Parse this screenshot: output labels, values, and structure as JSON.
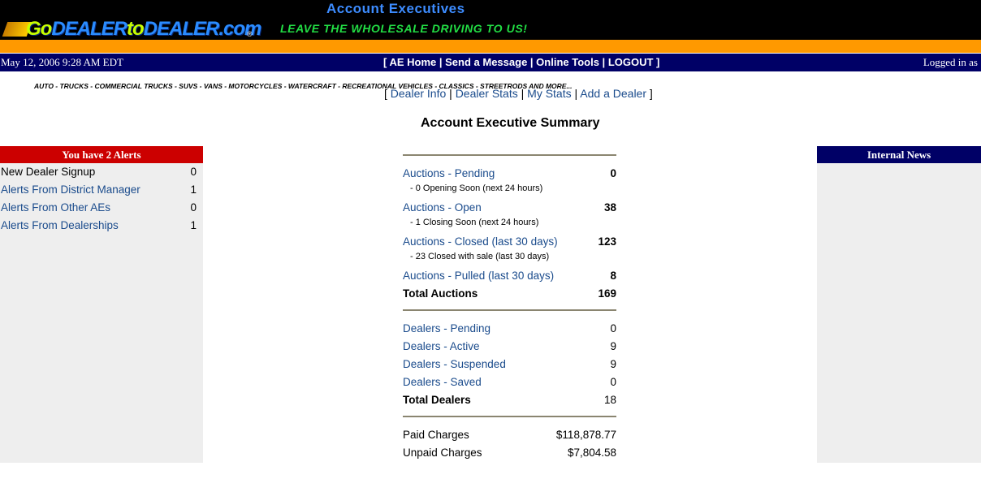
{
  "header": {
    "title": "Account Executives",
    "logo": {
      "go": "Go",
      "dealer1": "DEALER",
      "to": "to",
      "dealer2": "DEALER",
      "com": ".com",
      "reg": "®"
    },
    "tagline": "LEAVE THE WHOLESALE DRIVING TO US!",
    "categories": "AUTO - TRUCKS - COMMERCIAL TRUCKS - SUVS - VANS - MOTORCYCLES - WATERCRAFT - RECREATIONAL VEHICLES - CLASSICS - STREETRODS AND MORE...",
    "colors": {
      "bar": "#000000",
      "title": "#3d8cff",
      "tagline": "#22dd44",
      "orange": "#ff9900"
    }
  },
  "navbar": {
    "datetime": "May 12, 2006 9:28 AM EDT",
    "links": [
      "AE Home",
      "Send a Message",
      "Online Tools",
      "LOGOUT"
    ],
    "logged_in": "Logged in as",
    "color": "#000066"
  },
  "subnav": {
    "links": [
      "Dealer Info",
      "Dealer Stats",
      "My Stats",
      "Add a Dealer"
    ]
  },
  "page_title": "Account Executive Summary",
  "alerts": {
    "heading": "You have 2 Alerts",
    "color": "#cc0000",
    "items": [
      {
        "label": "New Dealer Signup",
        "count": "0"
      },
      {
        "label": "Alerts From District Manager",
        "count": "1"
      },
      {
        "label": "Alerts From Other AEs",
        "count": "0"
      },
      {
        "label": "Alerts From Dealerships",
        "count": "1"
      }
    ]
  },
  "news": {
    "heading": "Internal News"
  },
  "summary": {
    "auctions": {
      "pending": {
        "label": "Auctions - Pending",
        "value": "0",
        "note": "- 0 Opening Soon (next 24 hours)"
      },
      "open": {
        "label": "Auctions - Open",
        "value": "38",
        "note": "- 1 Closing Soon (next 24 hours)"
      },
      "closed": {
        "label": "Auctions - Closed (last 30 days)",
        "value": "123",
        "note": "- 23 Closed with sale (last 30 days)"
      },
      "pulled": {
        "label": "Auctions - Pulled (last 30 days)",
        "value": "8"
      },
      "total": {
        "label": "Total Auctions",
        "value": "169"
      }
    },
    "dealers": {
      "items": [
        {
          "label": "Dealers - Pending",
          "value": "0"
        },
        {
          "label": "Dealers - Active",
          "value": "9"
        },
        {
          "label": "Dealers - Suspended",
          "value": "9"
        },
        {
          "label": "Dealers - Saved",
          "value": "0"
        }
      ],
      "total": {
        "label": "Total Dealers",
        "value": "18"
      }
    },
    "charges": {
      "paid": {
        "label": "Paid Charges",
        "value": "$118,878.77"
      },
      "unpaid": {
        "label": "Unpaid Charges",
        "value": "$7,804.58"
      }
    }
  }
}
